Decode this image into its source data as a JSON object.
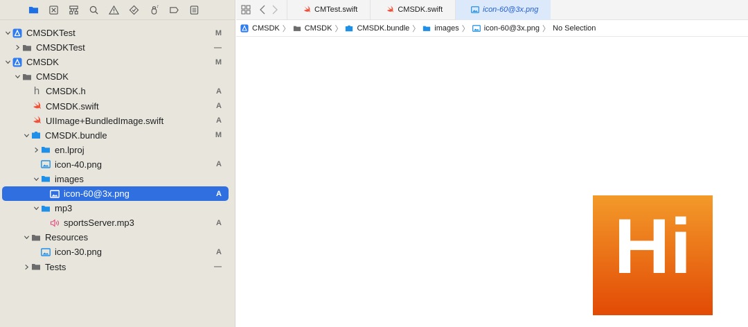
{
  "toolbar": {
    "icons": [
      "folder-icon",
      "source-control-icon",
      "hierarchy-icon",
      "search-icon",
      "warning-icon",
      "test-icon",
      "debug-icon",
      "breakpoint-icon",
      "report-icon"
    ]
  },
  "tree": [
    {
      "label": "CMSDKTest",
      "status": "M"
    },
    {
      "label": "CMSDKTest",
      "status": "—"
    },
    {
      "label": "CMSDK",
      "status": "M"
    },
    {
      "label": "CMSDK",
      "status": ""
    },
    {
      "label": "h",
      "name": "CMSDK.h",
      "status": "A"
    },
    {
      "label": "CMSDK.swift",
      "status": "A"
    },
    {
      "label": "UIImage+BundledImage.swift",
      "status": "A"
    },
    {
      "label": "CMSDK.bundle",
      "status": "M"
    },
    {
      "label": "en.lproj",
      "status": ""
    },
    {
      "label": "icon-40.png",
      "status": "A"
    },
    {
      "label": "images",
      "status": ""
    },
    {
      "label": "icon-60@3x.png",
      "status": "A"
    },
    {
      "label": "mp3",
      "status": ""
    },
    {
      "label": "sportsServer.mp3",
      "status": "A"
    },
    {
      "label": "Resources",
      "status": ""
    },
    {
      "label": "icon-30.png",
      "status": "A"
    },
    {
      "label": "Tests",
      "status": "—"
    }
  ],
  "tabs": [
    {
      "label": "CMTest.swift"
    },
    {
      "label": "CMSDK.swift"
    },
    {
      "label": "icon-60@3x.png"
    }
  ],
  "breadcrumb": [
    "CMSDK",
    "CMSDK",
    "CMSDK.bundle",
    "images",
    "icon-60@3x.png",
    "No Selection"
  ],
  "preview": {
    "text": "Hi"
  },
  "colors": {
    "selection": "#2f6fe0",
    "swift": "#f05138",
    "folder": "#1f8fe8",
    "image_top": "#f39a2a",
    "image_bottom": "#e24a05"
  }
}
